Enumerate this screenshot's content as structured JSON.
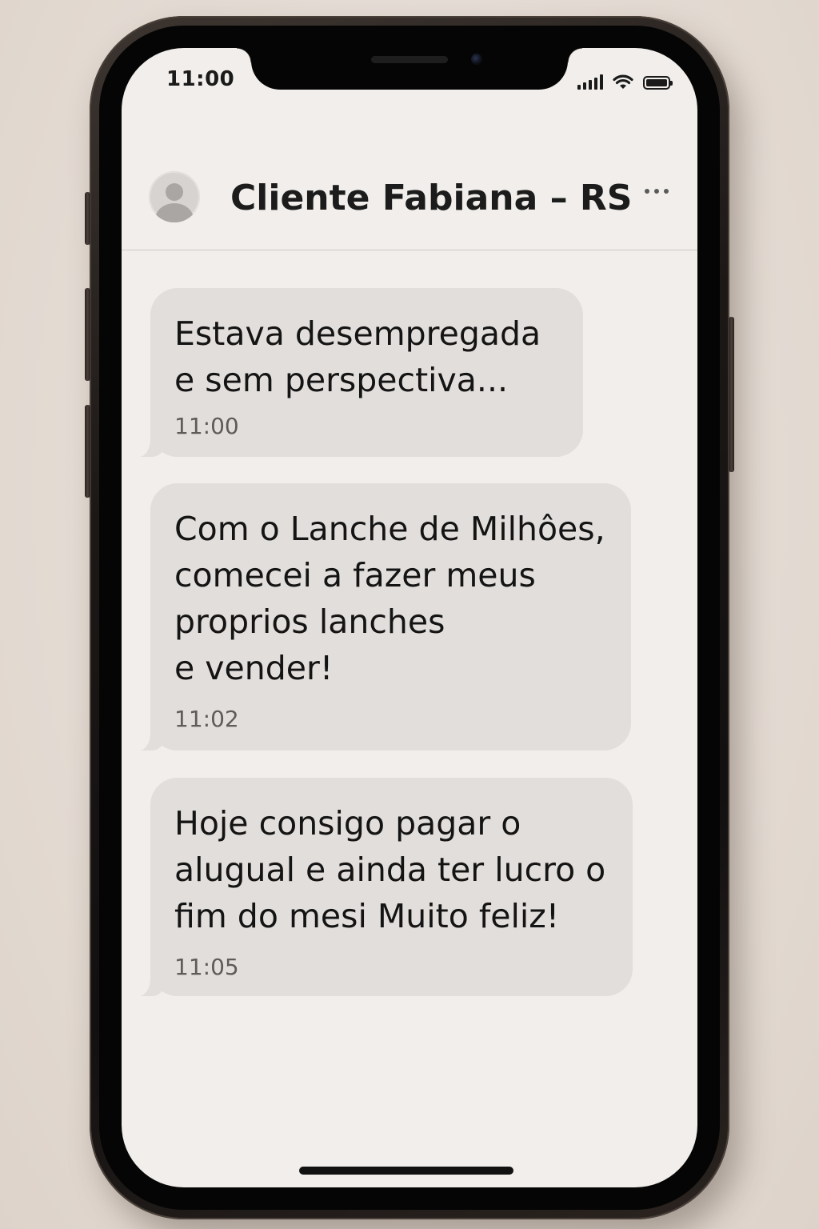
{
  "status_bar": {
    "time": "11:00",
    "signal_icon": "cellular-signal-icon",
    "wifi_icon": "wifi-icon",
    "battery_icon": "battery-full-icon"
  },
  "header": {
    "title": "Cliente Fabiana – RS",
    "avatar_icon": "person-avatar-icon",
    "more_icon": "more-options-icon"
  },
  "messages": [
    {
      "text": "Estava desempregada\ne sem perspectiva...",
      "time": "11:00"
    },
    {
      "text": "Com o Lanche de Milhôes,\ncomecei a fazer meus\nproprios lanches\ne vender!",
      "time": "11:02"
    },
    {
      "text": "Hoje consigo pagar o\nalugual e ainda ter lucro o\nfim do mesi Muito feliz!",
      "time": "11:05"
    }
  ],
  "colors": {
    "background": "#e6ddd6",
    "screen": "#f1eeeb",
    "bubble": "#e2dedb",
    "text": "#141414",
    "timestamp": "#5f5b58"
  }
}
